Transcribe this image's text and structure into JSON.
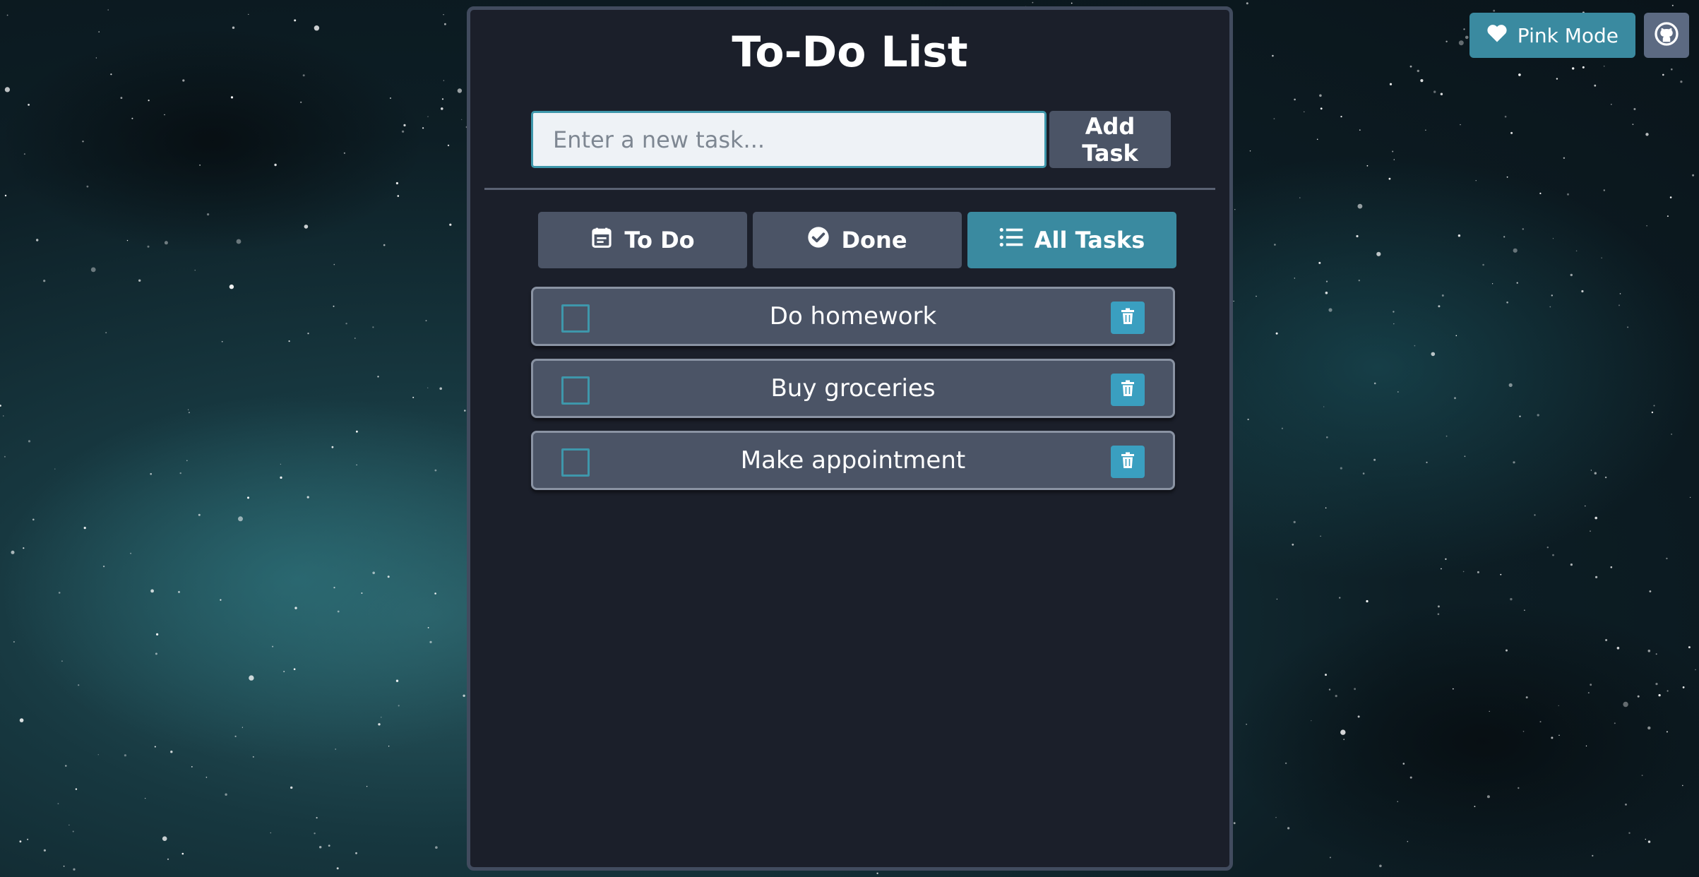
{
  "theme": {
    "accent": "#3a8aa0",
    "panel_bg": "#1b1f2a",
    "button_bg": "#4b5466"
  },
  "header_actions": {
    "pink_mode_label": "Pink Mode",
    "pink_mode_icon": "heart-icon",
    "github_icon": "github-icon"
  },
  "app": {
    "title": "To-Do List"
  },
  "new_task": {
    "placeholder": "Enter a new task...",
    "value": "",
    "add_label": "Add Task"
  },
  "filters": [
    {
      "label": "To Do",
      "icon": "calendar-icon",
      "active": false
    },
    {
      "label": "Done",
      "icon": "check-circle-icon",
      "active": false
    },
    {
      "label": "All Tasks",
      "icon": "list-icon",
      "active": true
    }
  ],
  "tasks": [
    {
      "label": "Do homework",
      "done": false
    },
    {
      "label": "Buy groceries",
      "done": false
    },
    {
      "label": "Make appointment",
      "done": false
    }
  ]
}
